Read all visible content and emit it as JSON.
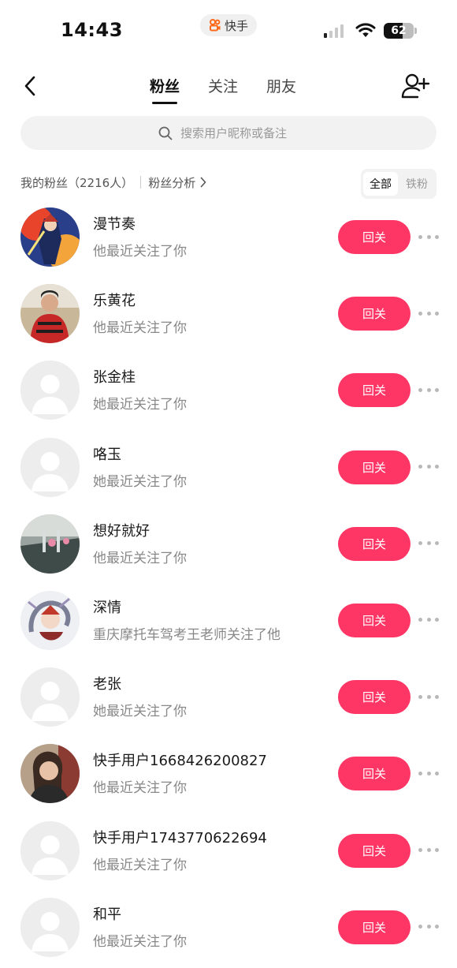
{
  "status_bar": {
    "time": "14:43",
    "app_name": "快手",
    "battery_percent": "62",
    "battery_level": 0.62,
    "signal_bars_active": 1
  },
  "nav": {
    "back_icon": "chevron-left-icon",
    "tabs": [
      {
        "label": "粉丝",
        "active": true
      },
      {
        "label": "关注",
        "active": false
      },
      {
        "label": "朋友",
        "active": false
      }
    ],
    "add_friend_icon": "add-user-icon"
  },
  "search": {
    "placeholder": "搜索用户昵称或备注",
    "icon": "search-icon"
  },
  "summary": {
    "fans_count_label": "我的粉丝（2216人）",
    "analysis_label": "粉丝分析",
    "filters": [
      {
        "label": "全部",
        "active": true
      },
      {
        "label": "铁粉",
        "active": false
      }
    ]
  },
  "colors": {
    "accent": "#fe3666",
    "text_primary": "#1a1a1a",
    "text_secondary": "#888888"
  },
  "fans": [
    {
      "name": "漫节奏",
      "subtitle": "他最近关注了你",
      "button": "回关",
      "avatar": "illustrated-warrior-photo"
    },
    {
      "name": "乐黄花",
      "subtitle": "他最近关注了你",
      "button": "回关",
      "avatar": "person-photo"
    },
    {
      "name": "张金桂",
      "subtitle": "她最近关注了你",
      "button": "回关",
      "avatar": "default"
    },
    {
      "name": "咯玉",
      "subtitle": "她最近关注了你",
      "button": "回关",
      "avatar": "default"
    },
    {
      "name": "想好就好",
      "subtitle": "他最近关注了你",
      "button": "回关",
      "avatar": "indoor-scene-photo"
    },
    {
      "name": "深情",
      "subtitle": "重庆摩托车驾考王老师关注了他",
      "button": "回关",
      "avatar": "dragon-art-photo"
    },
    {
      "name": "老张",
      "subtitle": "她最近关注了你",
      "button": "回关",
      "avatar": "default"
    },
    {
      "name": "快手用户1668426200827",
      "subtitle": "他最近关注了你",
      "button": "回关",
      "avatar": "woman-portrait-photo"
    },
    {
      "name": "快手用户1743770622694",
      "subtitle": "他最近关注了你",
      "button": "回关",
      "avatar": "default"
    },
    {
      "name": "和平",
      "subtitle": "他最近关注了你",
      "button": "回关",
      "avatar": "default"
    }
  ]
}
